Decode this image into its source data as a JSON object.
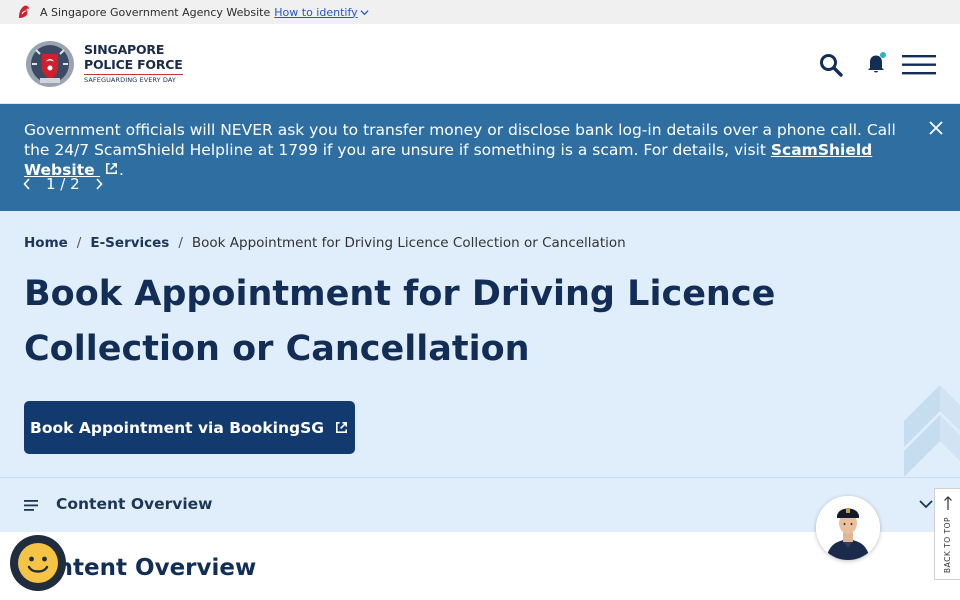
{
  "gov_bar": {
    "text": "A Singapore Government Agency Website",
    "identify_link": "How to identify"
  },
  "header": {
    "logo": {
      "line1": "SINGAPORE",
      "line2": "POLICE FORCE",
      "tagline": "SAFEGUARDING EVERY DAY"
    },
    "icons": [
      "search-icon",
      "bell-icon",
      "hamburger-menu-icon"
    ]
  },
  "alert": {
    "text_before_link": "Government officials will NEVER ask you to transfer money or disclose bank log-in details over a phone call. Call the 24/7 ScamShield Helpline at 1799 if you are unsure if something is a scam. For details, visit ",
    "link_label": "ScamShield Website",
    "text_after_link": ".",
    "pager": "1 / 2"
  },
  "breadcrumb": {
    "home": "Home",
    "sep1": "/",
    "eservices": "E-Services",
    "sep2": "/",
    "current": "Book Appointment for Driving Licence Collection or Cancellation"
  },
  "page": {
    "title": "Book Appointment for Driving Licence Collection or Cancellation",
    "cta_label": "Book Appointment via BookingSG"
  },
  "overview": {
    "label": "Content Overview",
    "heading": "Content Overview"
  },
  "back_to_top": "BACK TO TOP",
  "colors": {
    "alert_bg": "#2e6ea1",
    "hero_bg": "#dfeefa",
    "primary": "#123a6e",
    "title": "#122e57"
  }
}
